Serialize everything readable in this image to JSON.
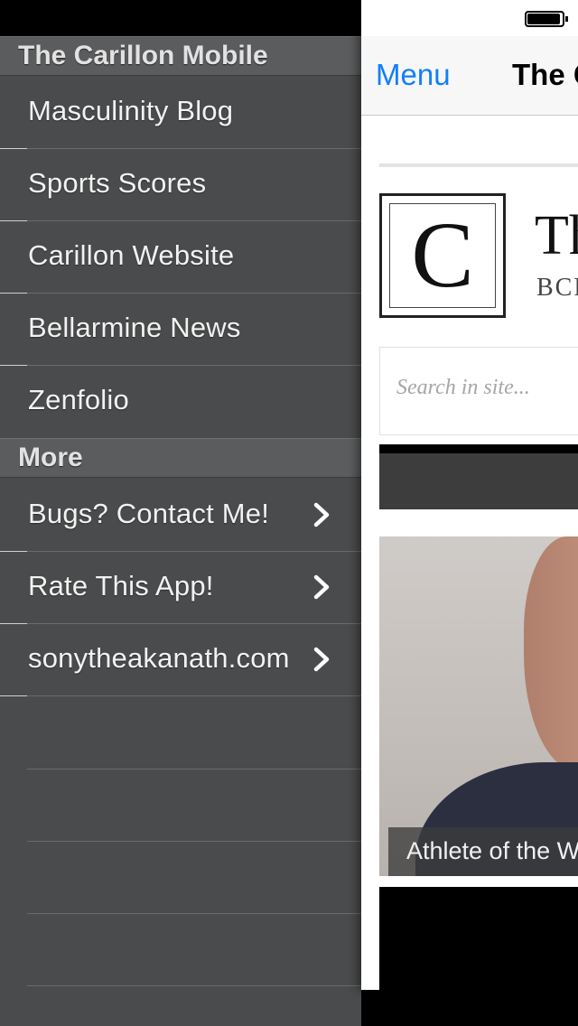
{
  "sidebar": {
    "header_title": "The Carillon Mobile",
    "items": [
      {
        "label": "Masculinity Blog"
      },
      {
        "label": "Sports Scores"
      },
      {
        "label": "Carillon Website"
      },
      {
        "label": "Bellarmine News"
      },
      {
        "label": "Zenfolio"
      }
    ],
    "more_title": "More",
    "more_items": [
      {
        "label": "Bugs? Contact Me!",
        "icon": "chevron-right-icon"
      },
      {
        "label": "Rate This App!",
        "icon": "chevron-right-icon"
      },
      {
        "label": "sonytheakanath.com",
        "icon": "chevron-right-icon"
      }
    ]
  },
  "webview": {
    "nav_menu_label": "Menu",
    "nav_title": "The C",
    "logo_letter": "C",
    "site_title": "Th",
    "site_subtitle": "BCP",
    "search_placeholder": "Search in site...",
    "photo_caption": "Athlete of the W"
  },
  "colors": {
    "sidebar_bg": "#4a4b4c",
    "section_header_bg": "#5b5c5e",
    "ios_blue": "#147efb"
  }
}
